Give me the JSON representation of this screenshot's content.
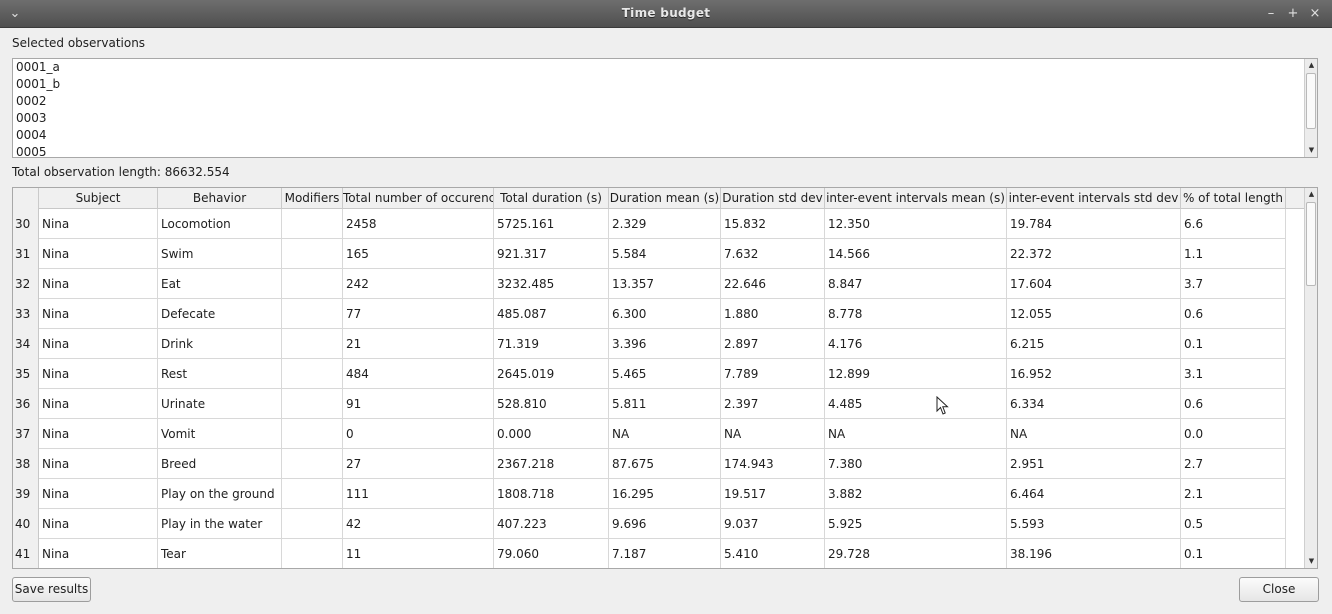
{
  "window": {
    "title": "Time budget",
    "menu_icon": "chevron-down-icon",
    "min_icon": "minimize-icon",
    "max_icon": "maximize-icon",
    "close_icon": "close-icon"
  },
  "observations": {
    "label": "Selected observations",
    "items": [
      "0001_a",
      "0001_b",
      "0002",
      "0003",
      "0004",
      "0005"
    ]
  },
  "total_length_text": "Total observation length: 86632.554",
  "table": {
    "headers": [
      "Subject",
      "Behavior",
      "Modifiers",
      "Total number of occurences",
      "Total duration (s)",
      "Duration mean (s)",
      "Duration std dev",
      "inter-event intervals mean (s)",
      "inter-event intervals std dev",
      "% of total length"
    ],
    "rows": [
      {
        "num": "30",
        "cells": [
          "Nina",
          "Locomotion",
          "",
          "2458",
          "5725.161",
          "2.329",
          "15.832",
          "12.350",
          "19.784",
          "6.6"
        ]
      },
      {
        "num": "31",
        "cells": [
          "Nina",
          "Swim",
          "",
          "165",
          "921.317",
          "5.584",
          "7.632",
          "14.566",
          "22.372",
          "1.1"
        ]
      },
      {
        "num": "32",
        "cells": [
          "Nina",
          "Eat",
          "",
          "242",
          "3232.485",
          "13.357",
          "22.646",
          "8.847",
          "17.604",
          "3.7"
        ]
      },
      {
        "num": "33",
        "cells": [
          "Nina",
          "Defecate",
          "",
          "77",
          "485.087",
          "6.300",
          "1.880",
          "8.778",
          "12.055",
          "0.6"
        ]
      },
      {
        "num": "34",
        "cells": [
          "Nina",
          "Drink",
          "",
          "21",
          "71.319",
          "3.396",
          "2.897",
          "4.176",
          "6.215",
          "0.1"
        ]
      },
      {
        "num": "35",
        "cells": [
          "Nina",
          "Rest",
          "",
          "484",
          "2645.019",
          "5.465",
          "7.789",
          "12.899",
          "16.952",
          "3.1"
        ]
      },
      {
        "num": "36",
        "cells": [
          "Nina",
          "Urinate",
          "",
          "91",
          "528.810",
          "5.811",
          "2.397",
          "4.485",
          "6.334",
          "0.6"
        ]
      },
      {
        "num": "37",
        "cells": [
          "Nina",
          "Vomit",
          "",
          "0",
          "0.000",
          "NA",
          "NA",
          "NA",
          "NA",
          "0.0"
        ]
      },
      {
        "num": "38",
        "cells": [
          "Nina",
          "Breed",
          "",
          "27",
          "2367.218",
          "87.675",
          "174.943",
          "7.380",
          "2.951",
          "2.7"
        ]
      },
      {
        "num": "39",
        "cells": [
          "Nina",
          "Play on the ground",
          "",
          "111",
          "1808.718",
          "16.295",
          "19.517",
          "3.882",
          "6.464",
          "2.1"
        ]
      },
      {
        "num": "40",
        "cells": [
          "Nina",
          "Play in the water",
          "",
          "42",
          "407.223",
          "9.696",
          "9.037",
          "5.925",
          "5.593",
          "0.5"
        ]
      },
      {
        "num": "41",
        "cells": [
          "Nina",
          "Tear",
          "",
          "11",
          "79.060",
          "7.187",
          "5.410",
          "29.728",
          "38.196",
          "0.1"
        ]
      }
    ]
  },
  "buttons": {
    "save": "Save results",
    "close": "Close"
  }
}
